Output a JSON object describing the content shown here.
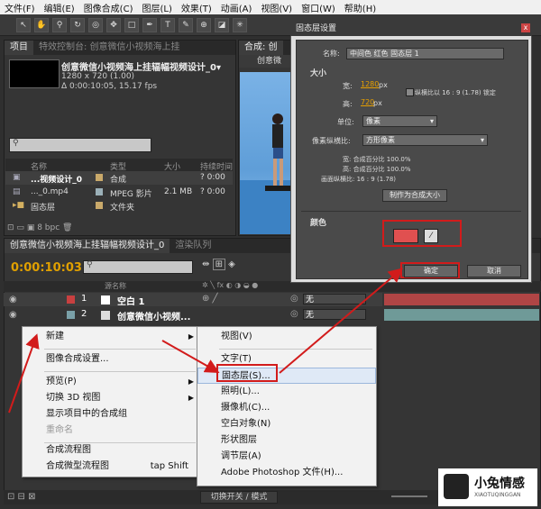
{
  "menubar": [
    "文件(F)",
    "编辑(E)",
    "图像合成(C)",
    "图层(L)",
    "效果(T)",
    "动画(A)",
    "视图(V)",
    "窗口(W)",
    "帮助(H)"
  ],
  "project_panel": {
    "tab_label": "项目",
    "tab2_label": "特效控制台: 创意微信小视频海上挂",
    "comp_name": "创意微信小视频海上挂辐幅视频设计_0▾",
    "comp_size": "1280 x 720 (1.00)",
    "comp_duration": "Δ 0:00:10:05, 15.17 fps",
    "columns": [
      "名称",
      "类型",
      "大小",
      "持续时间"
    ],
    "rows": [
      {
        "name": "...视频设计_0",
        "type": "合成",
        "size": "",
        "duration": "? 0:00"
      },
      {
        "name": "..._0.mp4",
        "type": "MPEG 影片",
        "size": "2.1 MB",
        "duration": "? 0:00"
      },
      {
        "name": "固态层",
        "type": "文件夹",
        "size": "",
        "duration": ""
      }
    ],
    "bpc_label": "8 bpc"
  },
  "viewer": {
    "tab_label": "合成: 创",
    "subtab": "创意微"
  },
  "timeline": {
    "tab_label": "创意微信小视频海上挂辐幅视频设计_0",
    "tab2_label": "渲染队列",
    "timecode": "0:00:10:03",
    "layer_header": "源名称",
    "layers": [
      {
        "num": "1",
        "name": "空白 1",
        "swatch": "#c84040",
        "mode": "无"
      },
      {
        "num": "2",
        "name": "创意微信小视频...",
        "swatch": "#7aa0a8",
        "mode": "无"
      }
    ],
    "status_label": "切换开关 / 模式"
  },
  "dialog": {
    "title": "固态层设置",
    "close": "x",
    "name_label": "名称:",
    "name_value": "中间色 红色 固态层 1",
    "size_section": "大小",
    "width_label": "宽:",
    "width_value": "1280",
    "width_unit": "px",
    "lock_label": "纵横比以 16 : 9 (1.78) 锁定",
    "height_label": "高:",
    "height_value": "720",
    "height_unit": "px",
    "units_label": "单位:",
    "units_value": "像素",
    "par_label": "像素纵横比:",
    "par_value": "方形像素",
    "info_w": "宽: 合成百分比 100.0%",
    "info_h": "高: 合成百分比 100.0%",
    "info_ratio": "画面纵横比: 16 : 9 (1.78)",
    "make_comp_size": "制作为合成大小",
    "color_section": "颜色",
    "color_value": "#e05050",
    "ok": "确定",
    "cancel": "取消"
  },
  "context_menu": {
    "items": [
      {
        "label": "新建",
        "submenu": true,
        "enabled": true
      },
      {
        "label": "图像合成设置...",
        "submenu": false,
        "enabled": true
      },
      {
        "label": "预览(P)",
        "submenu": true,
        "enabled": true
      },
      {
        "label": "切换 3D 视图",
        "submenu": true,
        "enabled": true
      },
      {
        "label": "显示项目中的合成组",
        "submenu": false,
        "enabled": true
      },
      {
        "label": "重命名",
        "submenu": false,
        "enabled": false
      },
      {
        "label": "合成流程图",
        "submenu": false,
        "enabled": true
      },
      {
        "label": "合成微型流程图",
        "shortcut": "tap Shift",
        "submenu": false,
        "enabled": true
      }
    ]
  },
  "new_submenu": {
    "items": [
      "视图(V)",
      "文字(T)",
      "固态层(S)...",
      "照明(L)...",
      "摄像机(C)...",
      "空白对象(N)",
      "形状图层",
      "调节层(A)",
      "Adobe Photoshop 文件(H)..."
    ]
  },
  "watermark": {
    "text": "小兔情感",
    "sub": "XIAOTUQINGGAN"
  },
  "colors": {
    "accent_red": "#d21b1b",
    "timecode": "#e0a000"
  }
}
